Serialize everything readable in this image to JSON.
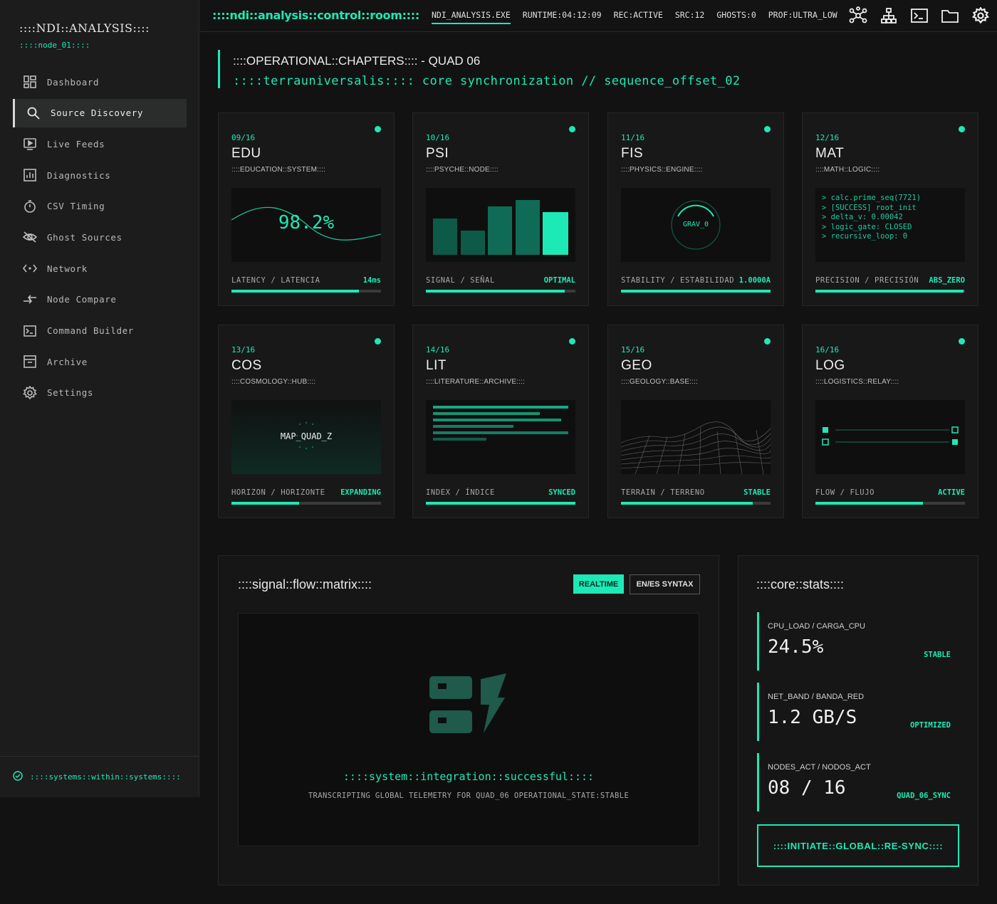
{
  "brand": {
    "title": "::::NDI::ANALYSIS::::",
    "node": "::::node_01::::"
  },
  "nav": [
    {
      "label": "Dashboard",
      "icon": "dashboard-icon"
    },
    {
      "label": "Source Discovery",
      "icon": "search-icon",
      "active": true
    },
    {
      "label": "Live Feeds",
      "icon": "play-icon"
    },
    {
      "label": "Diagnostics",
      "icon": "chart-icon"
    },
    {
      "label": "CSV Timing",
      "icon": "timer-icon"
    },
    {
      "label": "Ghost Sources",
      "icon": "eye-off-icon"
    },
    {
      "label": "Network",
      "icon": "network-icon"
    },
    {
      "label": "Node Compare",
      "icon": "compare-icon"
    },
    {
      "label": "Command Builder",
      "icon": "terminal-icon"
    },
    {
      "label": "Archive",
      "icon": "archive-icon"
    },
    {
      "label": "Settings",
      "icon": "gear-icon"
    }
  ],
  "footer": {
    "label": "::::systems::within::systems::::"
  },
  "topbar": {
    "logo": "::::ndi::analysis::control::room::::",
    "stats": [
      "NDI_ANALYSIS.EXE",
      "RUNTIME:04:12:09",
      "REC:ACTIVE",
      "SRC:12",
      "GHOSTS:0",
      "PROF:ULTRA_LOW"
    ]
  },
  "header": {
    "title": "::::OPERATIONAL::CHAPTERS:::: - QUAD 06",
    "subtitle": "::::terrauniversalis:::: core synchronization // sequence_offset_02"
  },
  "cards": [
    {
      "idx": "09/16",
      "code": "EDU",
      "sub": "::::EDUCATION::SYSTEM::::",
      "metric_label": "LATENCY / LATENCIA",
      "metric_value": "14ms",
      "progress": 0.85,
      "viz_text": "98.2%"
    },
    {
      "idx": "10/16",
      "code": "PSI",
      "sub": "::::PSYCHE::NODE::::",
      "metric_label": "SIGNAL / SEÑAL",
      "metric_value": "OPTIMAL",
      "progress": 0.93
    },
    {
      "idx": "11/16",
      "code": "FIS",
      "sub": "::::PHYSICS::ENGINE::::",
      "metric_label": "STABILITY / ESTABILIDAD",
      "metric_value": "1.0000A",
      "progress": 1.0,
      "viz_text": "GRAV_0"
    },
    {
      "idx": "12/16",
      "code": "MAT",
      "sub": "::::MATH::LOGIC::::",
      "metric_label": "PRECISION / PRECISIÓN",
      "metric_value": "ABS_ZERO",
      "progress": 0.99,
      "log": [
        "> calc.prime_seq(7721)",
        "> [SUCCESS] root_init",
        "> delta_v: 0.00042",
        "> logic_gate: CLOSED",
        "> recursive_loop: 0"
      ]
    },
    {
      "idx": "13/16",
      "code": "COS",
      "sub": "::::COSMOLOGY::HUB::::",
      "metric_label": "HORIZON / HORIZONTE",
      "metric_value": "EXPANDING",
      "progress": 0.45,
      "viz_text": "MAP_QUAD_Z"
    },
    {
      "idx": "14/16",
      "code": "LIT",
      "sub": "::::LITERATURE::ARCHIVE::::",
      "metric_label": "INDEX / ÍNDICE",
      "metric_value": "SYNCED",
      "progress": 1.0
    },
    {
      "idx": "15/16",
      "code": "GEO",
      "sub": "::::GEOLOGY::BASE::::",
      "metric_label": "TERRAIN / TERRENO",
      "metric_value": "STABLE",
      "progress": 0.88
    },
    {
      "idx": "16/16",
      "code": "LOG",
      "sub": "::::LOGISTICS::RELAY::::",
      "metric_label": "FLOW / FLUJO",
      "metric_value": "ACTIVE",
      "progress": 0.72
    }
  ],
  "matrix": {
    "title": "::::signal::flow::matrix::::",
    "btn_realtime": "REALTIME",
    "btn_syntax": "EN/ES SYNTAX",
    "msg1": "::::system::integration::successful::::",
    "msg2": "TRANSCRIPTING GLOBAL TELEMETRY FOR QUAD_06 OPERATIONAL_STATE:STABLE"
  },
  "core": {
    "title": "::::core::stats::::",
    "stats": [
      {
        "label": "CPU_LOAD / CARGA_CPU",
        "value": "24.5%",
        "status": "STABLE"
      },
      {
        "label": "NET_BAND / BANDA_RED",
        "value": "1.2 GB/S",
        "status": "OPTIMIZED"
      },
      {
        "label": "NODES_ACT / NODOS_ACT",
        "value": "08 / 16",
        "status": "QUAD_06_SYNC"
      }
    ],
    "resync": "::::INITIATE::GLOBAL::RE-SYNC::::"
  },
  "colors": {
    "accent": "#1de9b6",
    "bg": "#121212",
    "panel": "#181818"
  }
}
